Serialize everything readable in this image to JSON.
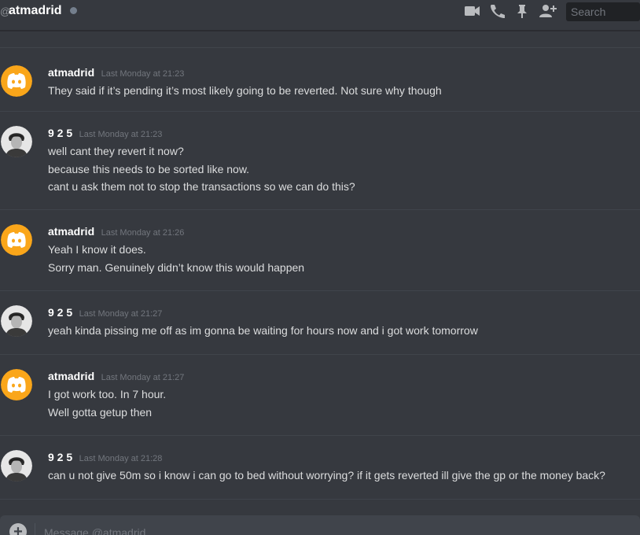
{
  "header": {
    "at_symbol": "@",
    "channel_name": "atmadrid",
    "status": "offline",
    "icons": [
      "video-call-icon",
      "voice-call-icon",
      "pin-icon",
      "add-friend-icon"
    ],
    "search_placeholder": "Search"
  },
  "colors": {
    "background": "#36393f",
    "header_text": "#ffffff",
    "message_text": "#dcddde",
    "timestamp": "#72767d",
    "discord_avatar_bg": "#faa61a",
    "composer_bg": "#40444b"
  },
  "messages": [
    {
      "author": "atmadrid",
      "avatar": "discord-logo",
      "timestamp": "Last Monday at 21:23",
      "lines": [
        "They said if it’s pending it’s most likely going to be reverted. Not sure why though"
      ]
    },
    {
      "author": "9 2 5",
      "avatar": "user-photo",
      "timestamp": "Last Monday at 21:23",
      "lines": [
        "well cant they revert it now?",
        "because this needs to be sorted like now.",
        "cant u ask them not to stop the transactions so we can do this?"
      ]
    },
    {
      "author": "atmadrid",
      "avatar": "discord-logo",
      "timestamp": "Last Monday at 21:26",
      "lines": [
        "Yeah I know it does.",
        "Sorry man. Genuinely didn’t know this would happen"
      ]
    },
    {
      "author": "9 2 5",
      "avatar": "user-photo",
      "timestamp": "Last Monday at 21:27",
      "lines": [
        "yeah kinda pissing me off as im gonna be waiting for hours now and i got work tomorrow"
      ]
    },
    {
      "author": "atmadrid",
      "avatar": "discord-logo",
      "timestamp": "Last Monday at 21:27",
      "lines": [
        "I got work too. In 7 hour.",
        "Well gotta getup then"
      ]
    },
    {
      "author": "9 2 5",
      "avatar": "user-photo",
      "timestamp": "Last Monday at 21:28",
      "lines": [
        "can u not give 50m so i know i can go to bed without worrying? if it gets reverted ill give the gp or the money back?"
      ]
    }
  ],
  "composer": {
    "placeholder": "Message @atmadrid"
  }
}
